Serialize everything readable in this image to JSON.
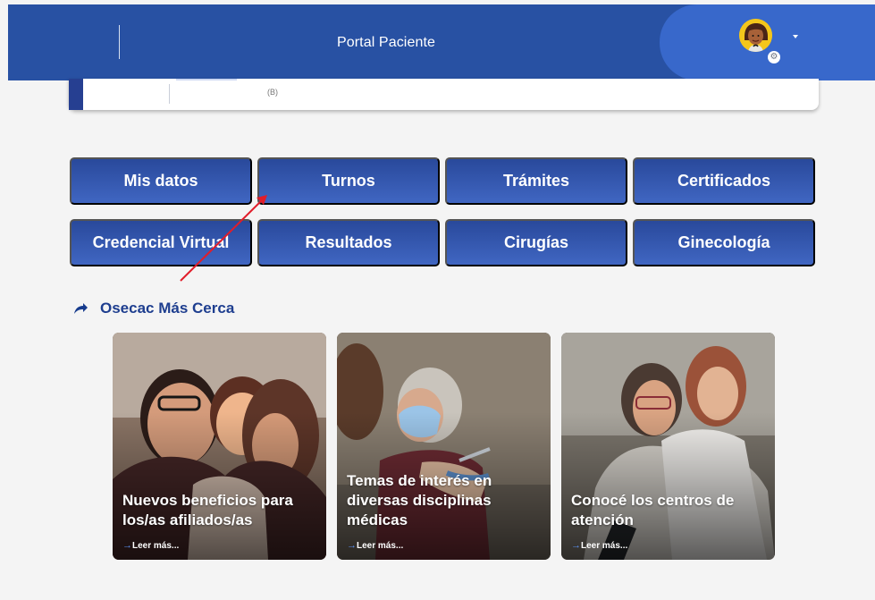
{
  "header": {
    "title": "Portal Paciente"
  },
  "info_card": {
    "code": "(B)"
  },
  "menu": {
    "buttons": [
      {
        "label": "Mis datos"
      },
      {
        "label": "Turnos"
      },
      {
        "label": "Trámites"
      },
      {
        "label": "Certificados"
      },
      {
        "label": "Credencial Virtual"
      },
      {
        "label": "Resultados"
      },
      {
        "label": "Cirugías"
      },
      {
        "label": "Ginecología"
      }
    ]
  },
  "section": {
    "title": "Osecac Más Cerca"
  },
  "cards": [
    {
      "title": "Nuevos beneficios para los/as afiliados/as",
      "link": "Leer más..."
    },
    {
      "title": "Temas de interés en diversas disciplinas médicas",
      "link": "Leer más..."
    },
    {
      "title": "Conocé los centros de atención",
      "link": "Leer más..."
    }
  ],
  "colors": {
    "header": "#2851a3",
    "user_panel": "#3868cb",
    "button_top": "#29499b",
    "button_bottom": "#4066c2",
    "section_title": "#1e3e8f"
  },
  "icons": {
    "section": "share-arrow-icon",
    "link": "arrow-right-icon",
    "avatar_badge": "gear-icon"
  }
}
